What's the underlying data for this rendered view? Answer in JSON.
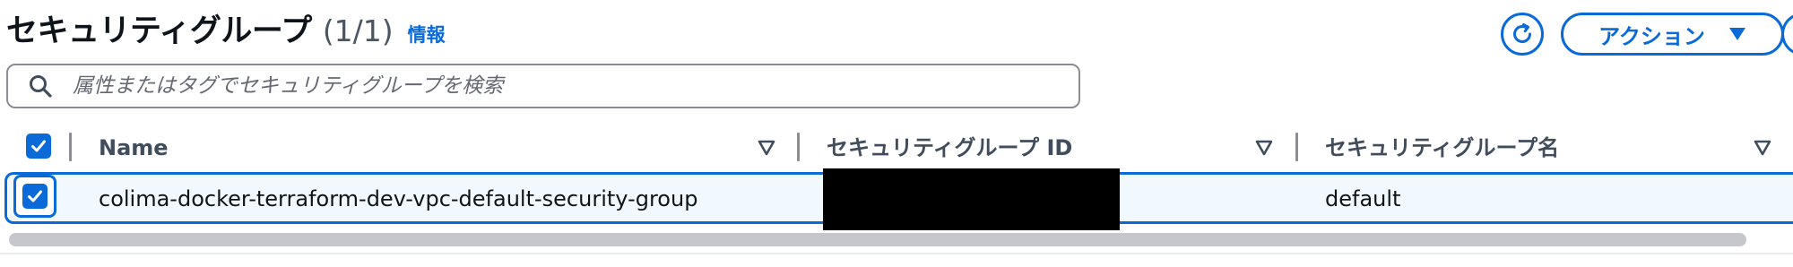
{
  "header": {
    "title": "セキュリティグループ",
    "count": "(1/1)",
    "info_label": "情報",
    "actions_label": "アクション"
  },
  "search": {
    "placeholder": "属性またはタグでセキュリティグループを検索",
    "value": ""
  },
  "table": {
    "columns": [
      {
        "label": "Name"
      },
      {
        "label": "セキュリティグループ ID"
      },
      {
        "label": "セキュリティグループ名"
      }
    ],
    "rows": [
      {
        "selected": true,
        "name": "colima-docker-terraform-dev-vpc-default-security-group",
        "security_group_id": "",
        "security_group_name": "default"
      }
    ],
    "header_checkbox_checked": true
  },
  "theme": {
    "accent": "#0a6ad8",
    "selected_row_bg": "#f1f9ff",
    "text": "#0f141a",
    "header_text": "#414d5c",
    "redaction": "#000000"
  },
  "icons": {
    "refresh": "refresh-icon",
    "dropdown": "caret-down-icon",
    "search": "search-icon",
    "sort": "sort-caret-icon",
    "check": "check-icon"
  }
}
